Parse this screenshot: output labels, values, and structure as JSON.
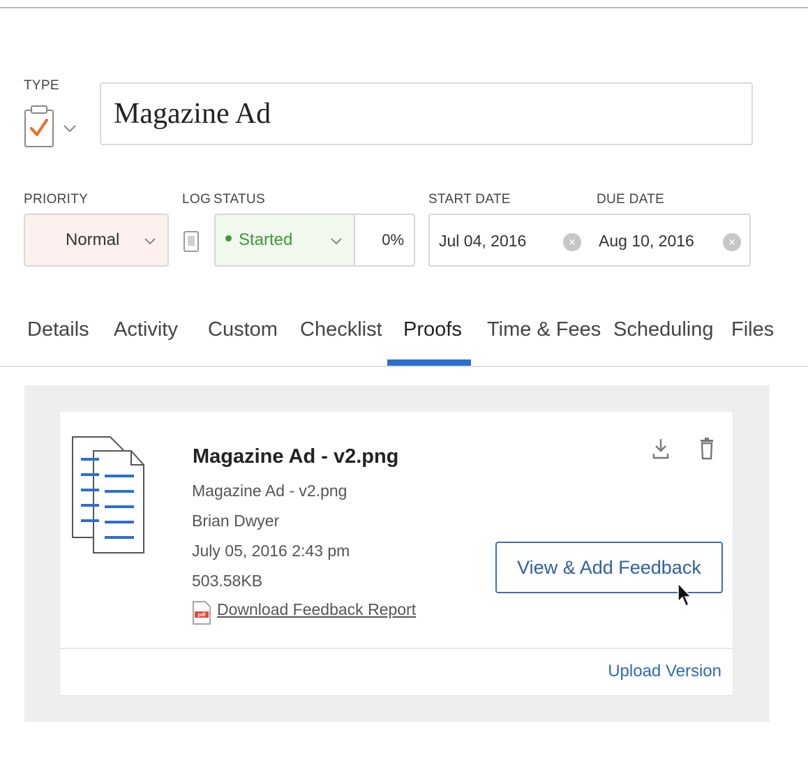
{
  "header": {
    "type_label": "TYPE",
    "title_value": "Magazine Ad"
  },
  "fields": {
    "priority_label": "PRIORITY",
    "priority_value": "Normal",
    "log_label": "LOG",
    "status_label": "STATUS",
    "status_value": "Started",
    "progress_value": "0%",
    "start_date_label": "START DATE",
    "start_date_value": "Jul 04, 2016",
    "due_date_label": "DUE DATE",
    "due_date_value": "Aug 10, 2016"
  },
  "tabs": [
    {
      "label": "Details"
    },
    {
      "label": "Activity"
    },
    {
      "label": "Custom"
    },
    {
      "label": "Checklist"
    },
    {
      "label": "Proofs"
    },
    {
      "label": "Time & Fees"
    },
    {
      "label": "Scheduling"
    },
    {
      "label": "Files"
    }
  ],
  "active_tab": "Proofs",
  "proof": {
    "title": "Magazine Ad - v2.png",
    "file_name": "Magazine Ad - v2.png",
    "author": "Brian Dwyer",
    "date": "July 05, 2016 2:43 pm",
    "size": "503.58KB",
    "report_link": "Download Feedback Report",
    "pdf_badge": "pdf",
    "feedback_button": "View & Add Feedback",
    "upload_link": "Upload Version"
  },
  "icons": {
    "type": "clipboard-check-icon",
    "log": "log-icon",
    "download": "download-icon",
    "delete": "trash-icon",
    "document": "documents-icon",
    "pdf": "pdf-file-icon",
    "cursor": "mouse-pointer-icon"
  },
  "colors": {
    "accent": "#2a6fd0",
    "status_green": "#3d9a34",
    "priority_bg": "#fdf0ef",
    "check_orange": "#e8702a"
  }
}
